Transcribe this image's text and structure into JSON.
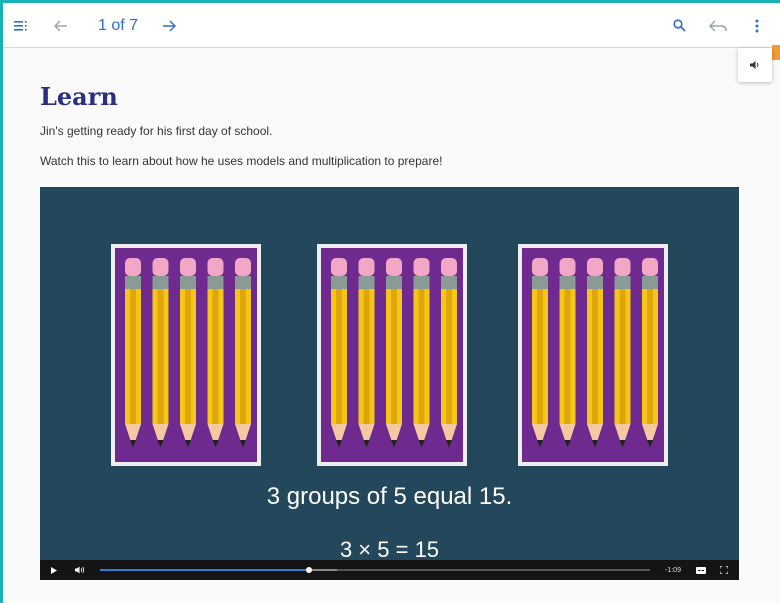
{
  "toolbar": {
    "page_count": "1 of 7",
    "menu_icon": "list-menu-icon",
    "back_icon": "arrow-left-icon",
    "forward_icon": "arrow-right-icon",
    "search_icon": "search-icon",
    "undo_icon": "undo-icon",
    "more_icon": "more-vertical-icon",
    "accent_color": "#2e6fc7"
  },
  "audio_button": {
    "icon": "speaker-icon"
  },
  "lesson": {
    "title": "Learn",
    "intro": "Jin's getting ready for his first day of school.",
    "instruction": "Watch this to learn about how he uses models and multiplication to prepare!"
  },
  "video": {
    "caption_line1": "3 groups of 5 equal 15.",
    "caption_line2": "3 × 5 = 15",
    "groups": 3,
    "pencils_per_group": 5,
    "time_remaining": "-1:09",
    "progress_fraction": 0.38,
    "buffered_fraction": 0.43,
    "background_color": "#23485c",
    "pack_color": "#6e2a8e"
  }
}
